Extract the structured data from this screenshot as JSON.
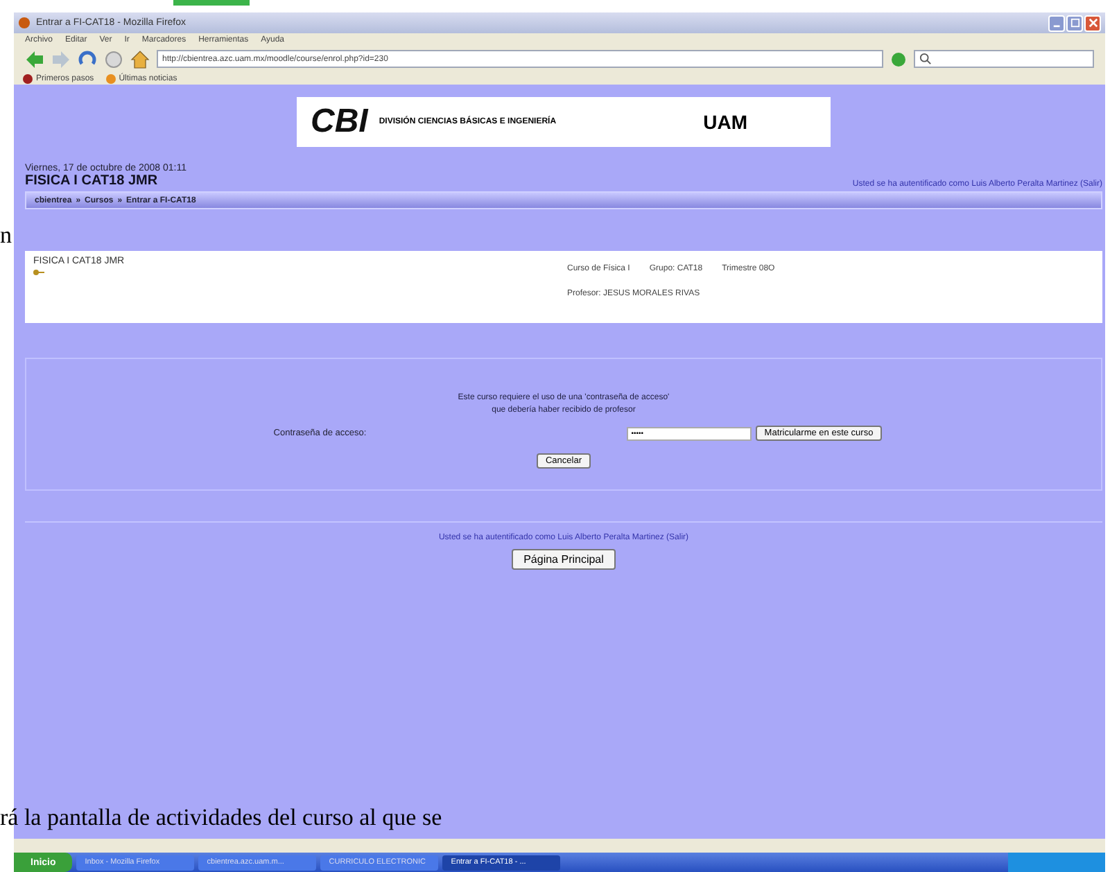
{
  "document": {
    "side_letter": "n",
    "caption": "rá la pantalla de actividades del curso al que se"
  },
  "window": {
    "title": "Entrar a FI-CAT18 - Mozilla Firefox",
    "menu": [
      "Archivo",
      "Editar",
      "Ver",
      "Ir",
      "Marcadores",
      "Herramientas",
      "Ayuda"
    ],
    "address": "http://cbientrea.azc.uam.mx/moodle/course/enrol.php?id=230",
    "bookmarks": [
      "Primeros pasos",
      "Últimas noticias"
    ]
  },
  "banner": {
    "logo": "CBI",
    "division": "DIVISIÓN CIENCIAS BÁSICAS E INGENIERÍA",
    "uam": "UAM"
  },
  "header": {
    "date": "Viernes, 17 de octubre de 2008 01:11",
    "course_title": "FISICA I CAT18 JMR",
    "login_info": "Usted se ha autentificado como Luis Alberto Peralta Martinez (Salir)"
  },
  "breadcrumb": {
    "separator": "»",
    "items": [
      "cbientrea",
      "Cursos",
      "Entrar a FI-CAT18"
    ]
  },
  "course": {
    "name": "FISICA I CAT18 JMR",
    "details": [
      "Curso de Física I",
      "Grupo: CAT18",
      "Trimestre 08O"
    ],
    "teacher": "Profesor: JESUS MORALES RIVAS"
  },
  "enrol": {
    "message": [
      "Este curso requiere el uso de una 'contraseña de acceso'",
      "que debería haber recibido de profesor"
    ],
    "field_label": "Contraseña de acceso:",
    "password": "•••••",
    "submit": "Matricularme en este curso",
    "cancel": "Cancelar"
  },
  "footer": {
    "login_info": "Usted se ha autentificado como Luis Alberto Peralta Martinez (Salir)",
    "home_button": "Página Principal"
  },
  "taskbar": {
    "start": "Inicio",
    "tasks": [
      {
        "label": "Inbox - Mozilla Firefox",
        "selected": false
      },
      {
        "label": "cbientrea.azc.uam.m...",
        "selected": false
      },
      {
        "label": "CURRICULO ELECTRONIC",
        "selected": false
      },
      {
        "label": "Entrar a FI-CAT18 - ...",
        "selected": true
      }
    ]
  }
}
